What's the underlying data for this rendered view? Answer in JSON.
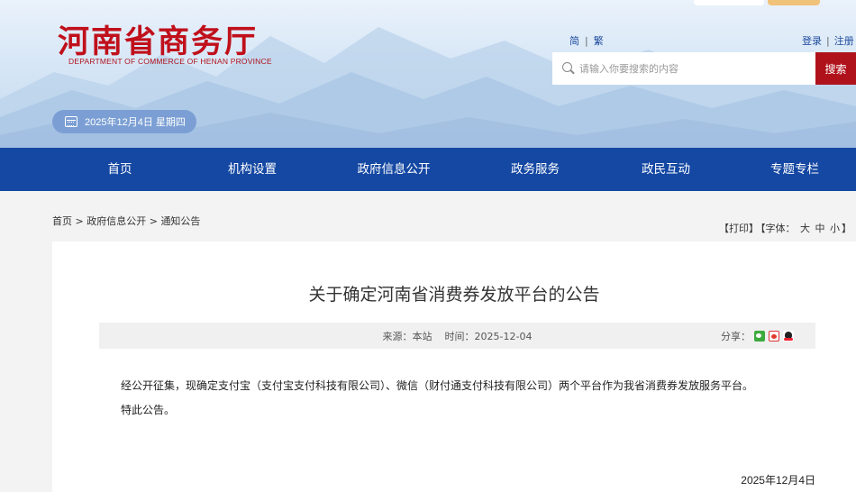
{
  "header": {
    "logo_cn": "河南省商务厅",
    "logo_en": "DEPARTMENT OF COMMERCE OF HENAN PROVINCE",
    "date": "2025年12月4日 星期四",
    "lang_simplified": "简",
    "lang_traditional": "繁",
    "login": "登录",
    "register": "注册",
    "search_placeholder": "请输入你要搜索的内容",
    "search_button": "搜索"
  },
  "nav": {
    "items": [
      {
        "label": "首页"
      },
      {
        "label": "机构设置"
      },
      {
        "label": "政府信息公开"
      },
      {
        "label": "政务服务"
      },
      {
        "label": "政民互动"
      },
      {
        "label": "专题专栏"
      }
    ]
  },
  "breadcrumb": {
    "items": [
      "首页",
      "政府信息公开",
      "通知公告"
    ],
    "separator": ">"
  },
  "tools": {
    "print": "【打印】",
    "font_label": "【字体：",
    "large": "大",
    "medium": "中",
    "small": "小",
    "close": "】"
  },
  "article": {
    "title": "关于确定河南省消费券发放平台的公告",
    "source": "来源：本站",
    "time": "时间：2025-12-04",
    "share_label": "分享：",
    "paragraphs": [
      "经公开征集，现确定支付宝（支付宝支付科技有限公司）、微信（财付通支付科技有限公司）两个平台作为我省消费券发放服务平台。",
      "特此公告。"
    ],
    "sign_date": "2025年12月4日"
  },
  "colors": {
    "brand_red": "#b0121c",
    "nav_blue": "#1548a3",
    "date_pill": "#7b9fd4"
  },
  "icons": [
    "search-icon",
    "calendar-icon",
    "wechat-icon",
    "weibo-icon",
    "qq-icon"
  ]
}
